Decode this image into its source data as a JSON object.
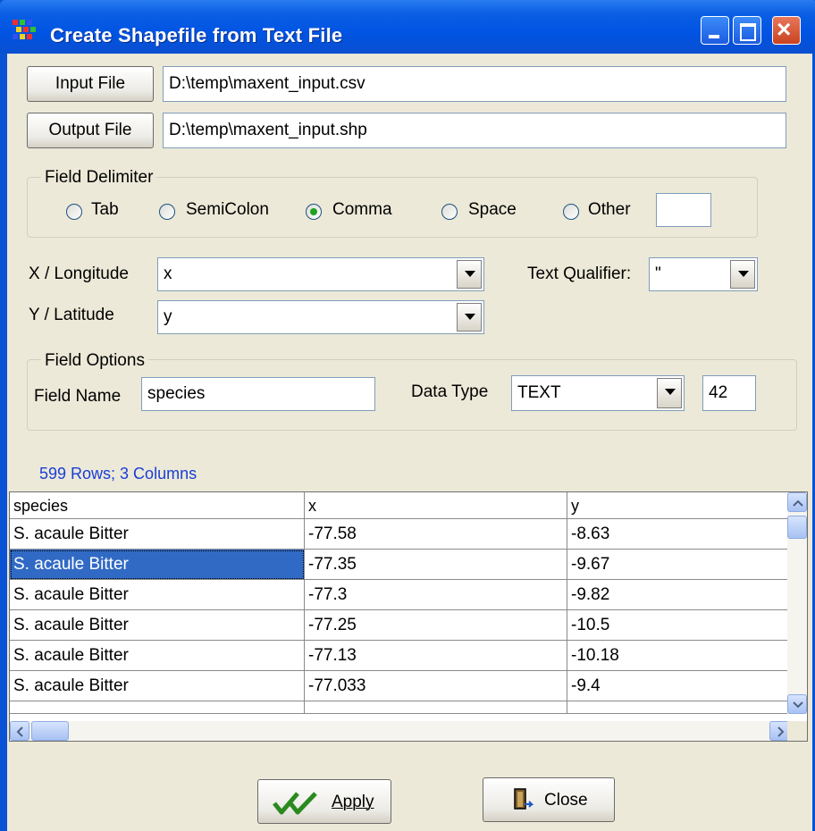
{
  "window": {
    "title": "Create Shapefile from Text File"
  },
  "input": {
    "button": "Input File",
    "value": "D:\\temp\\maxent_input.csv"
  },
  "output": {
    "button": "Output File",
    "value": "D:\\temp\\maxent_input.shp"
  },
  "delimiter": {
    "legend": "Field Delimiter",
    "options": [
      "Tab",
      "SemiColon",
      "Comma",
      "Space",
      "Other"
    ],
    "selected": "Comma",
    "other_value": ""
  },
  "coords": {
    "x_label": "X / Longitude",
    "x_value": "x",
    "y_label": "Y / Latitude",
    "y_value": "y",
    "qualifier_label": "Text Qualifier:",
    "qualifier_value": "\""
  },
  "field_options": {
    "legend": "Field Options",
    "name_label": "Field Name",
    "name_value": "species",
    "type_label": "Data Type",
    "type_value": "TEXT",
    "length": "42"
  },
  "summary": "599 Rows; 3 Columns",
  "table": {
    "columns": [
      "species",
      "x",
      "y"
    ],
    "rows": [
      [
        "S. acaule Bitter",
        "-77.58",
        "-8.63"
      ],
      [
        "S. acaule Bitter",
        "-77.35",
        "-9.67"
      ],
      [
        "S. acaule Bitter",
        "-77.3",
        "-9.82"
      ],
      [
        "S. acaule Bitter",
        "-77.25",
        "-10.5"
      ],
      [
        "S. acaule Bitter",
        "-77.13",
        "-10.18"
      ],
      [
        "S. acaule Bitter",
        "-77.033",
        "-9.4"
      ]
    ],
    "selected_row": 1
  },
  "buttons": {
    "apply": "Apply",
    "close": "Close"
  },
  "colors": {
    "titlebar": "#0054e3",
    "selection": "#316ac5",
    "summary_text": "#1a3ed6",
    "check_icon": "#2a8a1f"
  }
}
